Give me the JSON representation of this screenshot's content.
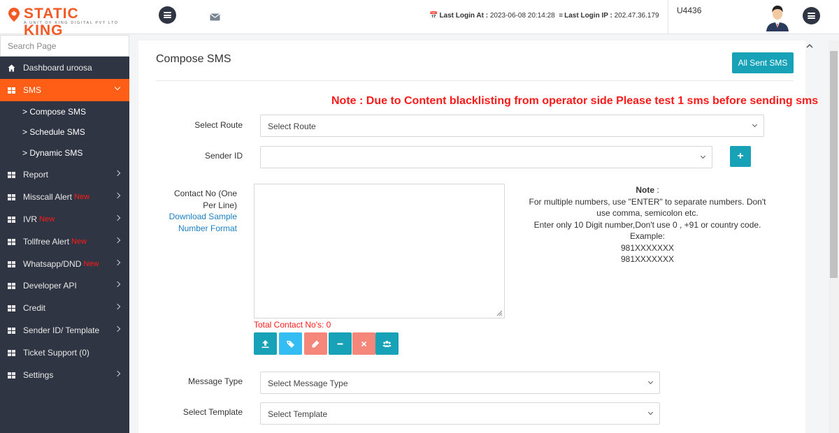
{
  "brand": {
    "name": "STATIC KING",
    "tagline": "A UNIT OF KING DIGITAL PVT LTD"
  },
  "header": {
    "last_login_label": "Last Login At :",
    "last_login_value": "2023-06-08 20:14:28",
    "last_ip_label": "Last Login IP :",
    "last_ip_value": "202.47.36.179",
    "user_id": "U4436"
  },
  "sidebar": {
    "search_placeholder": "Search Page",
    "items": [
      {
        "label": "Dashboard uroosa",
        "icon": "home-icon"
      },
      {
        "label": "SMS",
        "icon": "grid-icon",
        "active": true
      },
      {
        "label": "Report",
        "icon": "grid-icon"
      },
      {
        "label": "Misscall Alert",
        "badge": "New",
        "icon": "grid-icon"
      },
      {
        "label": "IVR",
        "badge": "New",
        "icon": "grid-icon"
      },
      {
        "label": "Tollfree Alert",
        "badge": "New",
        "icon": "grid-icon"
      },
      {
        "label": "Whatsapp/DND",
        "badge": "New",
        "icon": "grid-icon"
      },
      {
        "label": "Developer API",
        "icon": "grid-icon"
      },
      {
        "label": "Credit",
        "icon": "grid-icon"
      },
      {
        "label": "Sender ID/ Template",
        "icon": "grid-icon"
      },
      {
        "label": "Ticket Support (0)",
        "icon": "grid-icon"
      },
      {
        "label": "Settings",
        "icon": "grid-icon"
      }
    ],
    "sms_sub": [
      "> Compose SMS",
      "> Schedule SMS",
      "> Dynamic SMS"
    ]
  },
  "main": {
    "title": "Compose SMS",
    "all_sent_label": "All Sent SMS",
    "note_red": "Note : Due to Content blacklisting from operator side Please test 1 sms before sending sms",
    "route_label": "Select Route",
    "route_value": "Select Route",
    "sender_label": "Sender ID",
    "sender_value": "",
    "plus_label": "+",
    "contact_label_1": "Contact No (One Per Line)",
    "contact_link": "Download Sample Number Format",
    "note_title": "Note",
    "note_lines": [
      "For multiple numbers, use \"ENTER\" to separate numbers. Don't use comma, semicolon etc.",
      "Enter only 10 Digit number,Don't use 0 , +91 or country code.",
      "Example:",
      "981XXXXXXX",
      "981XXXXXXX"
    ],
    "total_contacts": "Total Contact No's: 0",
    "message_type_label": "Message Type",
    "message_type_value": "Select Message Type",
    "template_label": "Select Template",
    "template_value": "Select Template"
  },
  "colors": {
    "accent_orange": "#ff5e16",
    "teal": "#17a2b8",
    "sky": "#33bdf2",
    "salmon": "#f4867a",
    "sidebar_bg": "#2f3542",
    "alert_red": "#ff1a1a"
  }
}
